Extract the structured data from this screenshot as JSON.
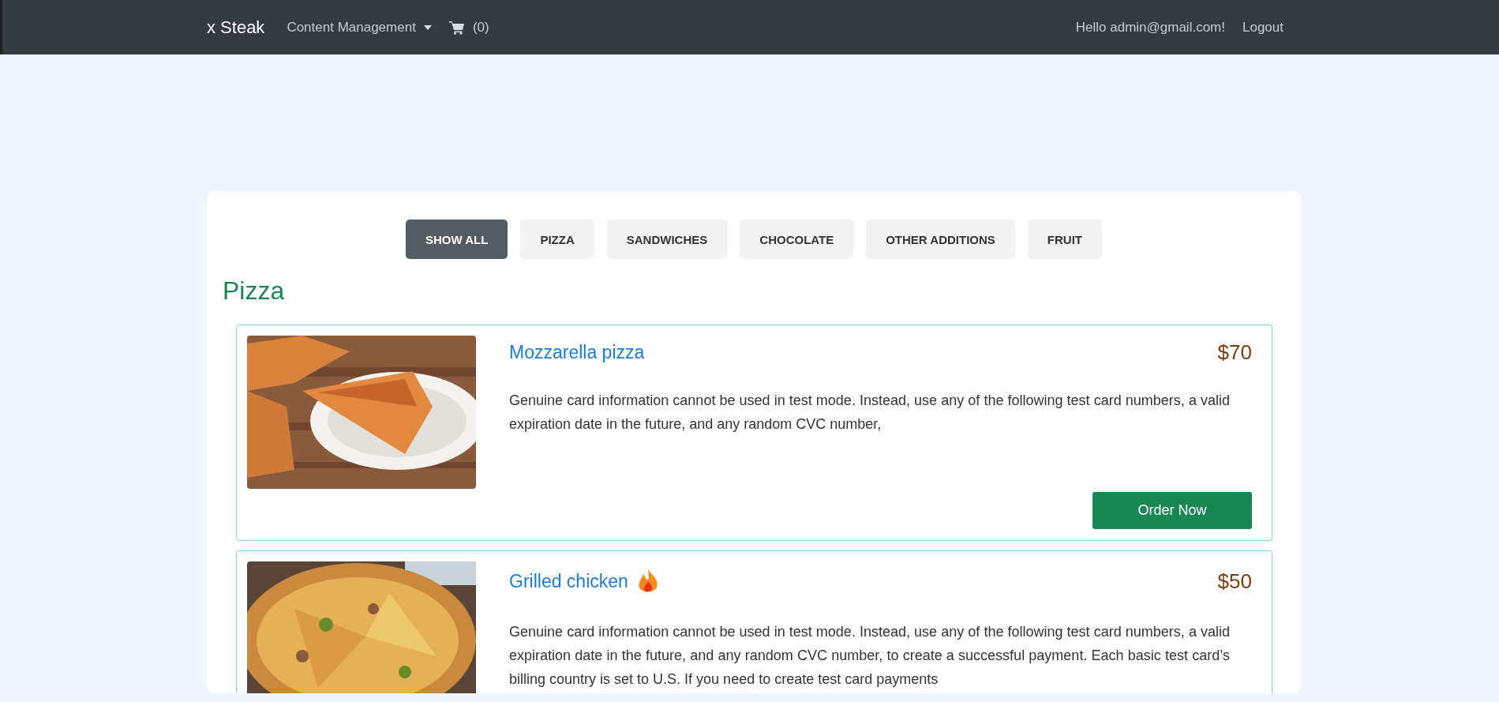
{
  "navbar": {
    "brand": "x Steak",
    "menu_label": "Content Management",
    "cart_count": "(0)",
    "greeting": "Hello admin@gmail.com!",
    "logout": "Logout"
  },
  "filters": [
    {
      "label": "SHOW ALL",
      "selected": true
    },
    {
      "label": "PIZZA",
      "selected": false
    },
    {
      "label": "SANDWICHES",
      "selected": false
    },
    {
      "label": "CHOCOLATE",
      "selected": false
    },
    {
      "label": "OTHER ADDITIONS",
      "selected": false
    },
    {
      "label": "FRUIT",
      "selected": false
    }
  ],
  "section_title": "Pizza",
  "products": [
    {
      "name": "Mozzarella pizza",
      "price": "$70",
      "description": "Genuine card information cannot be used in test mode. Instead, use any of the following test card numbers, a valid expiration date in the future, and any random CVC number,",
      "button": "Order Now"
    },
    {
      "name": "Grilled chicken",
      "hot": true,
      "price": "$50",
      "description": "Genuine card information cannot be used in test mode. Instead, use any of the following test card numbers, a valid expiration date in the future, and any random CVC number, to create a successful payment. Each basic test card’s billing country is set to U.S. If you need to create test card payments"
    }
  ]
}
